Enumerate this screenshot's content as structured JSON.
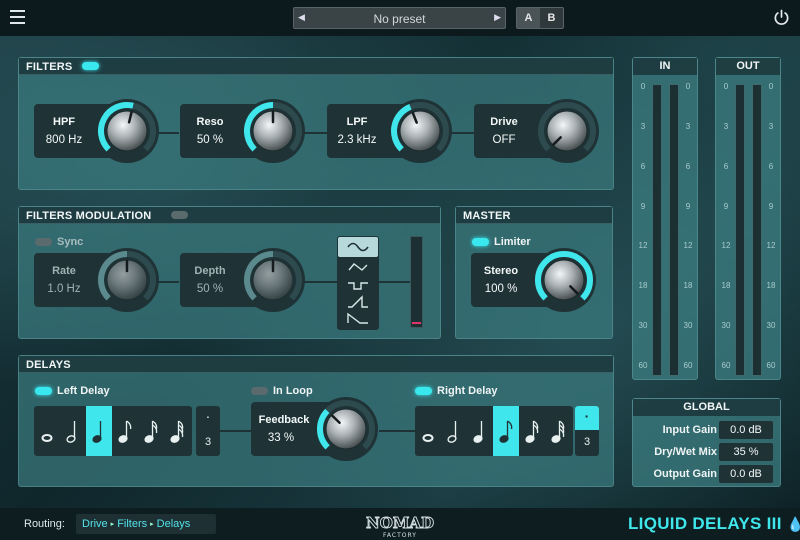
{
  "topbar": {
    "menu_icon": "hamburger-menu-icon",
    "preset_name": "No preset",
    "ab": [
      "A",
      "B"
    ],
    "power_icon": "power-icon"
  },
  "filters": {
    "title": "FILTERS",
    "enabled": true,
    "knobs": [
      {
        "name": "HPF",
        "value": "800 Hz",
        "level": 0.55
      },
      {
        "name": "Reso",
        "value": "50 %",
        "level": 0.5
      },
      {
        "name": "LPF",
        "value": "2.3 kHz",
        "level": 0.42
      },
      {
        "name": "Drive",
        "value": "OFF",
        "level": 0.0
      }
    ]
  },
  "filters_modulation": {
    "title": "FILTERS MODULATION",
    "enabled": false,
    "sync_label": "Sync",
    "sync_on": false,
    "knobs": [
      {
        "name": "Rate",
        "value": "1.0 Hz",
        "level": 0.5
      },
      {
        "name": "Depth",
        "value": "50 %",
        "level": 0.5
      }
    ],
    "waveforms": [
      "sine-wave-icon",
      "triangle-wave-icon",
      "square-wave-icon",
      "saw-up-wave-icon",
      "saw-down-wave-icon"
    ],
    "selected_waveform": 0
  },
  "master": {
    "title": "MASTER",
    "limiter_label": "Limiter",
    "limiter_on": true,
    "knob": {
      "name": "Stereo",
      "value": "100 %",
      "level": 1.0
    }
  },
  "meters": {
    "in_label": "IN",
    "out_label": "OUT",
    "ticks": [
      "0",
      "3",
      "6",
      "9",
      "12",
      "18",
      "30",
      "60"
    ]
  },
  "global": {
    "title": "GLOBAL",
    "rows": [
      {
        "label": "Input Gain",
        "value": "0.0 dB"
      },
      {
        "label": "Dry/Wet Mix",
        "value": "35 %"
      },
      {
        "label": "Output Gain",
        "value": "0.0 dB"
      }
    ]
  },
  "delays": {
    "title": "DELAYS",
    "left_label": "Left Delay",
    "left_on": true,
    "in_loop_label": "In Loop",
    "in_loop_on": false,
    "right_label": "Right Delay",
    "right_on": true,
    "left_notes": [
      "whole-note-icon",
      "half-note-icon",
      "quarter-note-icon",
      "eighth-note-icon",
      "sixteenth-note-icon",
      "thirty-second-note-icon"
    ],
    "left_selected": 2,
    "left_triplet_dot": "·",
    "left_triplet_num": "3",
    "left_triplet_on": false,
    "right_notes": [
      "whole-note-icon",
      "half-note-icon",
      "quarter-note-icon",
      "eighth-note-icon",
      "sixteenth-note-icon",
      "thirty-second-note-icon"
    ],
    "right_selected": 3,
    "right_triplet_dot": "·",
    "right_triplet_num": "3",
    "right_triplet_on": true,
    "feedback": {
      "name": "Feedback",
      "value": "33 %",
      "level": 0.33
    }
  },
  "bottom": {
    "routing_label": "Routing:",
    "routing": [
      "Drive",
      "Filters",
      "Delays"
    ],
    "brand": "NOMAD FACTORY",
    "product": "LIQUID DELAYS III"
  },
  "colors": {
    "accent": "#3fe6ec",
    "panel": "#3a7a7e",
    "dark": "#1f3336"
  }
}
